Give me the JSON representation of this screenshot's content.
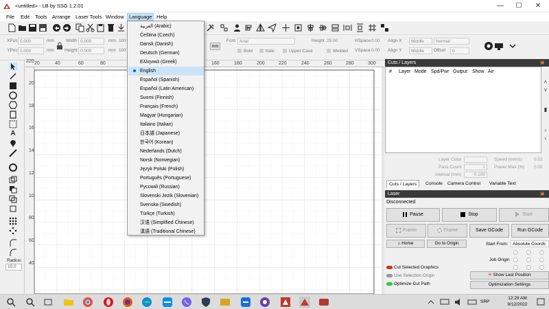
{
  "window": {
    "title": "<untitled> - LB by SSG 1.2.01",
    "minimize": "—",
    "maximize": "☐",
    "close": "✕"
  },
  "menubar": [
    "File",
    "Edit",
    "Tools",
    "Arrange",
    "Laser Tools",
    "Window",
    "Language",
    "Help"
  ],
  "language_menu": {
    "items": [
      "العربية (Arabic)",
      "Čeština (Czech)",
      "Dansk (Danish)",
      "Deutsch (German)",
      "Ελληνικά (Greek)",
      "English",
      "Español (Spanish)",
      "Español (Latin American)",
      "Suomi (Finnish)",
      "Français (French)",
      "Magyar (Hungarian)",
      "Italiano (Italian)",
      "日本語 (Japanese)",
      "한국어 (Korean)",
      "Nederlands (Dutch)",
      "Norsk (Norwegian)",
      "Język Polski (Polish)",
      "Português (Portuguese)",
      "Русский (Russian)",
      "Slovenski Jezik (Slovenian)",
      "Svenska (Swedish)",
      "Türkçe (Turkish)",
      "汉语 (Simplified Chinese)",
      "漢語 (Traditional Chinese)"
    ],
    "selected": "English"
  },
  "propbar": {
    "xpos_label": "XPos",
    "xpos_value": "0.000",
    "ypos_label": "YPos",
    "ypos_value": "0.000",
    "unit_mm": "mm",
    "width_label": "Width",
    "width_value": "0.000",
    "height_label": "Height",
    "height_value": "0.000",
    "w100": "100",
    "h100": "100",
    "mm_button": "mm",
    "font_label": "Font",
    "font_value": "Arial",
    "font_height_label": "Height",
    "font_height_value": "25.00",
    "hspace_label": "HSpace",
    "hspace_value": "0.00",
    "vspace_label": "VSpace",
    "vspace_value": "0.00",
    "alignx_label": "Align X",
    "alignx_value": "Middle",
    "aligny_label": "Align Y",
    "aligny_value": "Middle",
    "normal_value": "Normal",
    "offset_label": "Offset",
    "offset_value": "0",
    "bold": "Bold",
    "italic": "Italic",
    "upper_case": "Upper Case",
    "welded": "Welded"
  },
  "ruler_top": [
    "20",
    "40",
    "60",
    "80",
    "160",
    "180",
    "200",
    "220",
    "240",
    "260",
    "280",
    "300"
  ],
  "ruler_left": [
    "200",
    "180",
    "160",
    "140",
    "120",
    "100",
    "80",
    "60",
    "40"
  ],
  "ruler_corner": "220",
  "tools": {
    "radius_label": "Radius:",
    "radius_value": "10.0"
  },
  "cuts_panel": {
    "title": "Cuts / Layers",
    "columns": [
      "#",
      "Layer",
      "Mode",
      "Spd/Pwr",
      "Output",
      "Show",
      "Air"
    ],
    "layer_color_label": "Layer Color",
    "pass_count_label": "Pass Count",
    "pass_count_value": "1",
    "interval_label": "Interval (mm)",
    "interval_value": "0.100",
    "speed_label": "Speed (mm/s)",
    "speed_value": "0.02",
    "power_label": "Power Max (%)",
    "power_value": "0.00"
  },
  "tabs": [
    "Cuts / Layers",
    "Console",
    "Camera Control",
    "Variable Text"
  ],
  "laser": {
    "title": "Laser",
    "status": "Disconnected",
    "pause": "Pause",
    "stop": "Stop",
    "start": "Start",
    "frame1": "Frame",
    "frame2": "Frame",
    "save_gcode": "Save GCode",
    "run_gcode": "Run GCode",
    "home": "Home",
    "go_to_origin": "Go to Origin",
    "start_from_label": "Start From:",
    "start_from_value": "Absolute Coords",
    "job_origin_label": "Job Origin",
    "cut_selected": "Cut Selected Graphics",
    "use_selection_origin": "Use Selection Origin",
    "optimize_cut_path": "Optimize Cut Path",
    "show_last_position": "Show Last Position",
    "optimization_settings": "Optimization Settings"
  },
  "taskbar": {
    "lang": "SRP",
    "time": "12:29 AM",
    "date": "9/12/2022"
  },
  "colors": {
    "menu_highlight": "#cce4f7",
    "panel_header": "#3a3a3a",
    "toggle_red": "#c0392b",
    "toggle_green": "#2ecc40"
  }
}
